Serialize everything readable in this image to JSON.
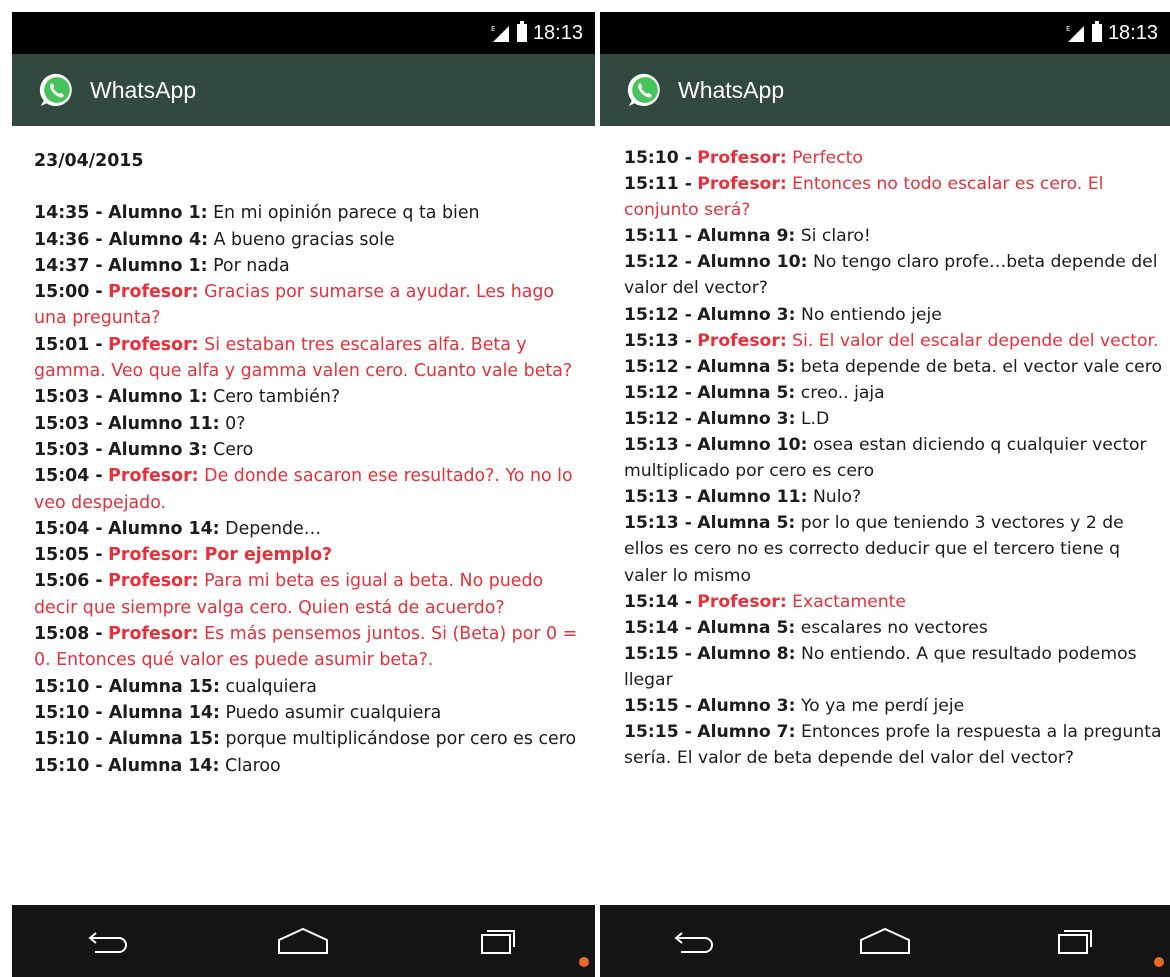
{
  "left": {
    "status": {
      "time": "18:13"
    },
    "app_title": "WhatsApp",
    "date": "23/04/2015",
    "messages": [
      {
        "time": "14:35 -",
        "author": "Alumno 1:",
        "text": "En mi opinión parece q ta bien",
        "prof": false
      },
      {
        "time": "14:36 - ",
        "author": "Alumno 4:",
        "text": "A bueno gracias sole",
        "prof": false
      },
      {
        "time": "14:37 -",
        "author": "Alumno 1:",
        "text": "Por nada",
        "prof": false
      },
      {
        "time": "15:00 -",
        "author": "Profesor:",
        "text": "Gracias por sumarse a ayudar. Les hago una pregunta?",
        "prof": true
      },
      {
        "time": "15:01 -",
        "author": "Profesor:",
        "text": "Si estaban tres escalares alfa. Beta y gamma. Veo que alfa y gamma valen cero. Cuanto vale beta?",
        "prof": true
      },
      {
        "time": "15:03 -",
        "author": "Alumno 1:",
        "text": "Cero también?",
        "prof": false
      },
      {
        "time": "15:03 -",
        "author": "Alumno 11:",
        "text": "0?",
        "prof": false
      },
      {
        "time": "15:03 -",
        "author": "Alumno 3:",
        "text": "Cero",
        "prof": false
      },
      {
        "time": "15:04 -",
        "author": "Profesor:",
        "text": "De donde sacaron ese resultado?. Yo no lo veo despejado.",
        "prof": true
      },
      {
        "time": "15:04 -",
        "author": "Alumno 14:",
        "text": "Depende…",
        "prof": false
      },
      {
        "time": "15:05 -",
        "author": "Profesor: Por ejemplo?",
        "text": "",
        "prof": true
      },
      {
        "time": "15:06 -",
        "author": "Profesor:",
        "text": "Para mi beta es igual a beta. No puedo decir que siempre valga cero. Quien está de acuerdo?",
        "prof": true
      },
      {
        "time": "15:08 -",
        "author": "Profesor:",
        "text": "Es más pensemos juntos. Si (Beta) por 0 = 0. Entonces qué valor es puede asumir beta?.",
        "prof": true
      },
      {
        "time": "15:10 - ",
        "author": "Alumna 15:",
        "text": "cualquiera",
        "prof": false
      },
      {
        "time": "15:10 - ",
        "author": "Alumna 14:",
        "text": "Puedo asumir cualquiera",
        "prof": false
      },
      {
        "time": "15:10 - ",
        "author": "Alumna 15:",
        "text": "porque multiplicándose  por cero es cero",
        "prof": false
      },
      {
        "time": "15:10 -",
        "author": "Alumna 14:",
        "text": "Claroo",
        "prof": false
      }
    ]
  },
  "right": {
    "status": {
      "time": "18:13"
    },
    "app_title": "WhatsApp",
    "messages": [
      {
        "time": "15:10 -",
        "author": "Profesor:",
        "text": "Perfecto",
        "prof": true
      },
      {
        "time": "15:11 -",
        "author": "Profesor:",
        "text": "Entonces no todo escalar es cero. El conjunto será?",
        "prof": true
      },
      {
        "time": "15:11 -",
        "author": "Alumna 9:",
        "text": "Si claro!",
        "prof": false
      },
      {
        "time": "15:12 -",
        "author": "Alumno 10:",
        "text": "No tengo claro profe…beta depende del valor del vector?",
        "prof": false
      },
      {
        "time": "15:12 -",
        "author": "Alumno 3:",
        "text": "No entiendo jeje",
        "prof": false
      },
      {
        "time": "15:13 -",
        "author": "Profesor:",
        "text": "Si. El valor del escalar depende del vector.",
        "prof": true
      },
      {
        "time": "15:12 -",
        "author": "Alumna 5:",
        "text": "beta depende de beta. el vector vale cero",
        "prof": false
      },
      {
        "time": "15:12 -",
        "author": "Alumna 5:",
        "text": "creo.. jaja",
        "prof": false
      },
      {
        "time": "15:12 -",
        "author": "Alumno 3:",
        "text": "L.D",
        "prof": false
      },
      {
        "time": "15:13 -",
        "author": "Alumno 10:",
        "text": "osea estan diciendo q cualquier vector multiplicado por cero es cero",
        "prof": false
      },
      {
        "time": "15:13 -",
        "author": "Alumno 11:",
        "text": "Nulo?",
        "prof": false
      },
      {
        "time": "15:13 -",
        "author": "Alumna 5:",
        "text": "por lo que teniendo 3 vectores y 2 de ellos es cero no es correcto deducir que el tercero tiene q valer lo mismo",
        "prof": false
      },
      {
        "time": "15:14 -",
        "author": "Profesor:",
        "text": "Exactamente",
        "prof": true
      },
      {
        "time": "15:14 -",
        "author": "Alumna 5:",
        "text": "escalares no vectores",
        "prof": false
      },
      {
        "time": "15:15 -",
        "author": "Alumno 8:",
        "text": "No entiendo. A que resultado podemos llegar",
        "prof": false
      },
      {
        "time": "15:15 -",
        "author": "Alumno 3:",
        "text": "Yo ya me perdí jeje",
        "prof": false
      },
      {
        "time": "15:15 -",
        "author": "Alumno 7:",
        "text": "Entonces profe la respuesta a la pregunta sería. El valor de beta depende del valor del vector?",
        "prof": false
      }
    ]
  },
  "icons": {
    "signal": "signal-icon",
    "battery": "battery-icon",
    "app": "whatsapp-icon",
    "back": "back-icon",
    "home": "home-icon",
    "recents": "recents-icon"
  },
  "colors": {
    "app_bar": "#32493f",
    "professor": "#e8303a",
    "status_bar": "#000000",
    "nav_bar": "#141414"
  }
}
